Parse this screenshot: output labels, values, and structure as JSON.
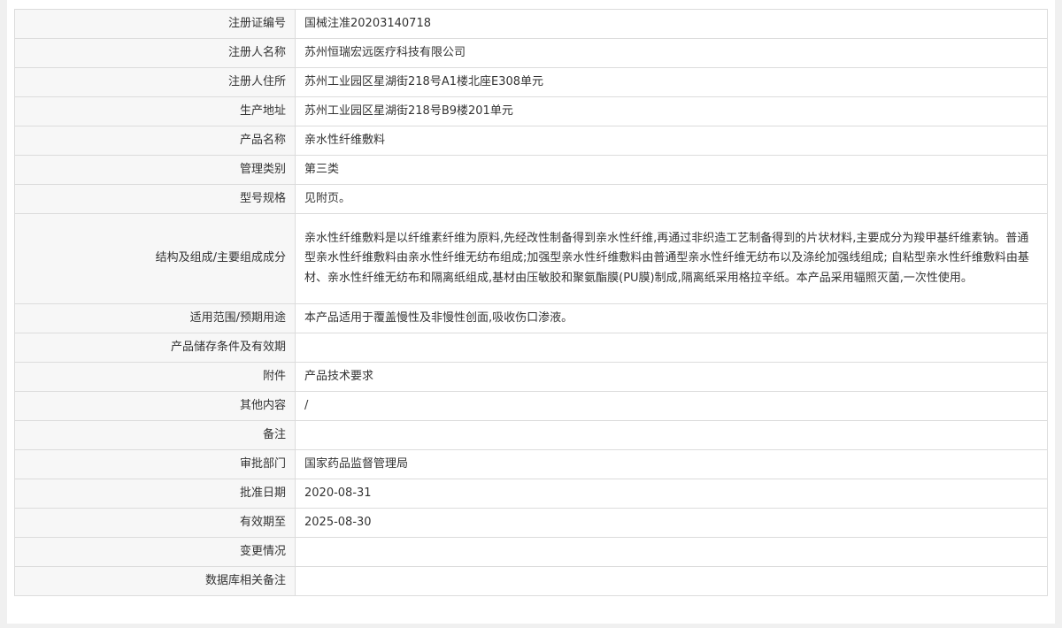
{
  "record": {
    "rows": [
      {
        "label": "注册证编号",
        "value": "国械注准20203140718"
      },
      {
        "label": "注册人名称",
        "value": "苏州恒瑞宏远医疗科技有限公司"
      },
      {
        "label": "注册人住所",
        "value": "苏州工业园区星湖街218号A1楼北座E308单元"
      },
      {
        "label": "生产地址",
        "value": "苏州工业园区星湖街218号B9楼201单元"
      },
      {
        "label": "产品名称",
        "value": "亲水性纤维敷料"
      },
      {
        "label": "管理类别",
        "value": "第三类"
      },
      {
        "label": "型号规格",
        "value": "见附页。"
      },
      {
        "label": "结构及组成/主要组成成分",
        "value": "亲水性纤维敷料是以纤维素纤维为原料,先经改性制备得到亲水性纤维,再通过非织造工艺制备得到的片状材料,主要成分为羧甲基纤维素钠。普通型亲水性纤维敷料由亲水性纤维无纺布组成;加强型亲水性纤维敷料由普通型亲水性纤维无纺布以及涤纶加强线组成; 自粘型亲水性纤维敷料由基材、亲水性纤维无纺布和隔离纸组成,基材由压敏胶和聚氨酯膜(PU膜)制成,隔离纸采用格拉辛纸。本产品采用辐照灭菌,一次性使用。"
      },
      {
        "label": "适用范围/预期用途",
        "value": "本产品适用于覆盖慢性及非慢性创面,吸收伤口渗液。"
      },
      {
        "label": "产品储存条件及有效期",
        "value": ""
      },
      {
        "label": "附件",
        "value": "产品技术要求"
      },
      {
        "label": "其他内容",
        "value": "/"
      },
      {
        "label": "备注",
        "value": ""
      },
      {
        "label": "审批部门",
        "value": "国家药品监督管理局"
      },
      {
        "label": "批准日期",
        "value": "2020-08-31"
      },
      {
        "label": "有效期至",
        "value": "2025-08-30"
      },
      {
        "label": "变更情况",
        "value": ""
      },
      {
        "label": "数据库相关备注",
        "value": ""
      }
    ]
  }
}
